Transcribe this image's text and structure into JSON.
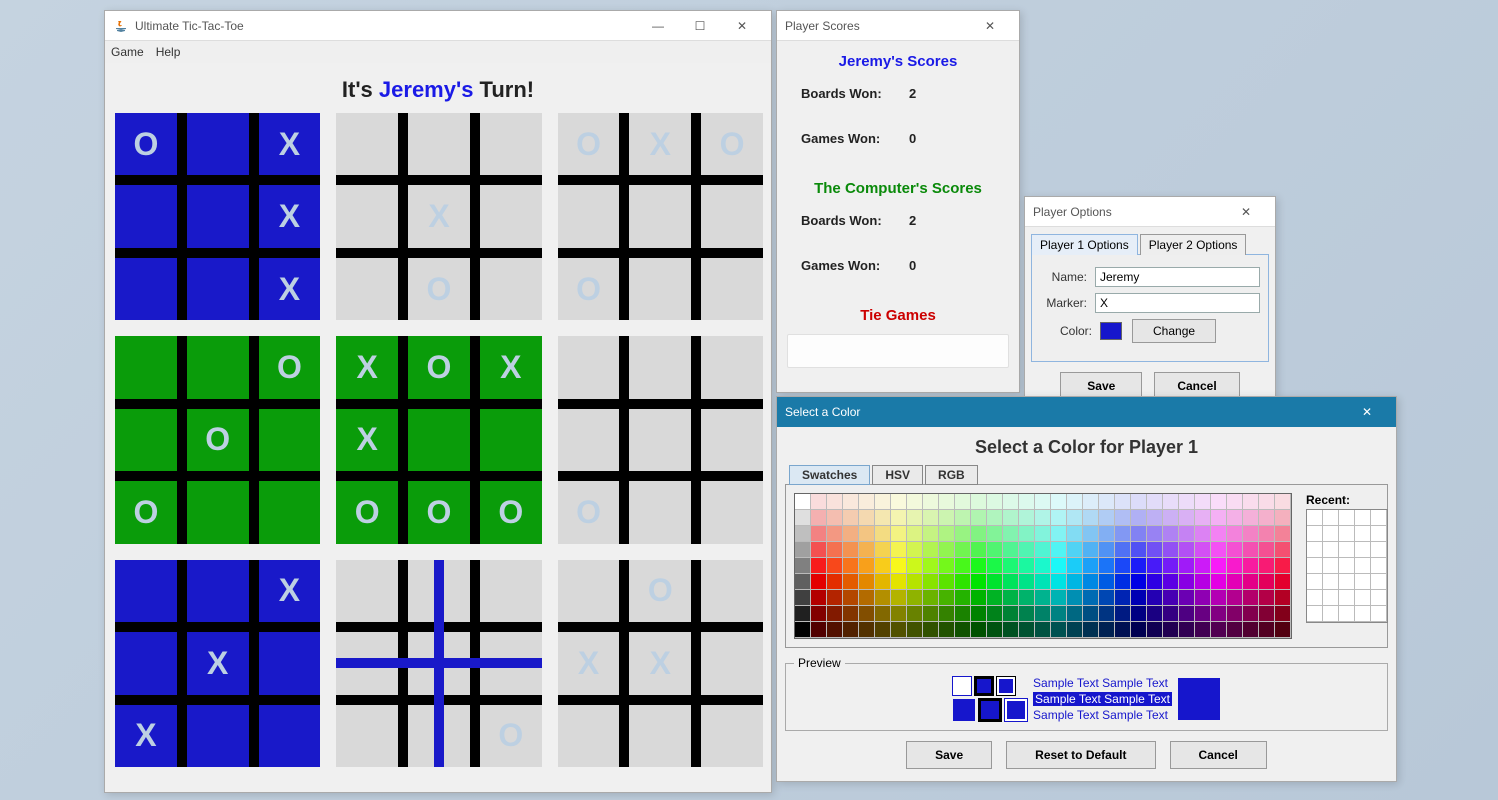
{
  "main": {
    "title": "Ultimate Tic-Tac-Toe",
    "menu": {
      "game": "Game",
      "help": "Help"
    },
    "turn_prefix": "It's ",
    "turn_player": "Jeremy's",
    "turn_suffix": " Turn!",
    "boards": [
      {
        "style": "blue",
        "cells": [
          "O",
          "",
          "X",
          "",
          "",
          "X",
          "",
          "",
          "X"
        ]
      },
      {
        "style": "plain",
        "cells": [
          "",
          "",
          "",
          "",
          "X",
          "",
          "",
          "O",
          ""
        ]
      },
      {
        "style": "plain",
        "cells": [
          "O",
          "X",
          "O",
          "",
          "",
          "",
          "O",
          "",
          ""
        ]
      },
      {
        "style": "green",
        "cells": [
          "",
          "",
          "O",
          "",
          "O",
          "",
          "O",
          "",
          ""
        ]
      },
      {
        "style": "green",
        "cells": [
          "X",
          "O",
          "X",
          "X",
          "",
          "",
          "O",
          "O",
          "O"
        ]
      },
      {
        "style": "plain",
        "cells": [
          "",
          "",
          "",
          "",
          "",
          "",
          "O",
          "",
          ""
        ]
      },
      {
        "style": "blue",
        "cells": [
          "",
          "",
          "X",
          "",
          "X",
          "",
          "X",
          "",
          ""
        ]
      },
      {
        "style": "cross",
        "cells": [
          "",
          "",
          "",
          "",
          "",
          "",
          "",
          "",
          "O"
        ]
      },
      {
        "style": "plain",
        "cells": [
          "",
          "O",
          "",
          "X",
          "X",
          "",
          "",
          "",
          ""
        ]
      }
    ]
  },
  "scores": {
    "title": "Player Scores",
    "p1": {
      "heading": "Jeremy's Scores",
      "boards_label": "Boards Won:",
      "boards": "2",
      "games_label": "Games Won:",
      "games": "0"
    },
    "p2": {
      "heading": "The Computer's Scores",
      "boards_label": "Boards Won:",
      "boards": "2",
      "games_label": "Games Won:",
      "games": "0"
    },
    "tie": "Tie Games"
  },
  "options": {
    "title": "Player Options",
    "tab1": "Player 1 Options",
    "tab2": "Player 2 Options",
    "name_label": "Name:",
    "name_value": "Jeremy",
    "marker_label": "Marker:",
    "marker_value": "X",
    "color_label": "Color:",
    "color_value": "#1616cc",
    "change": "Change",
    "save": "Save",
    "cancel": "Cancel"
  },
  "color": {
    "title": "Select a Color",
    "heading": "Select a Color for Player 1",
    "tab_swatches": "Swatches",
    "tab_hsv": "HSV",
    "tab_rgb": "RGB",
    "recent": "Recent:",
    "preview": "Preview",
    "sample": "Sample Text",
    "save": "Save",
    "reset": "Reset to Default",
    "cancel": "Cancel"
  }
}
